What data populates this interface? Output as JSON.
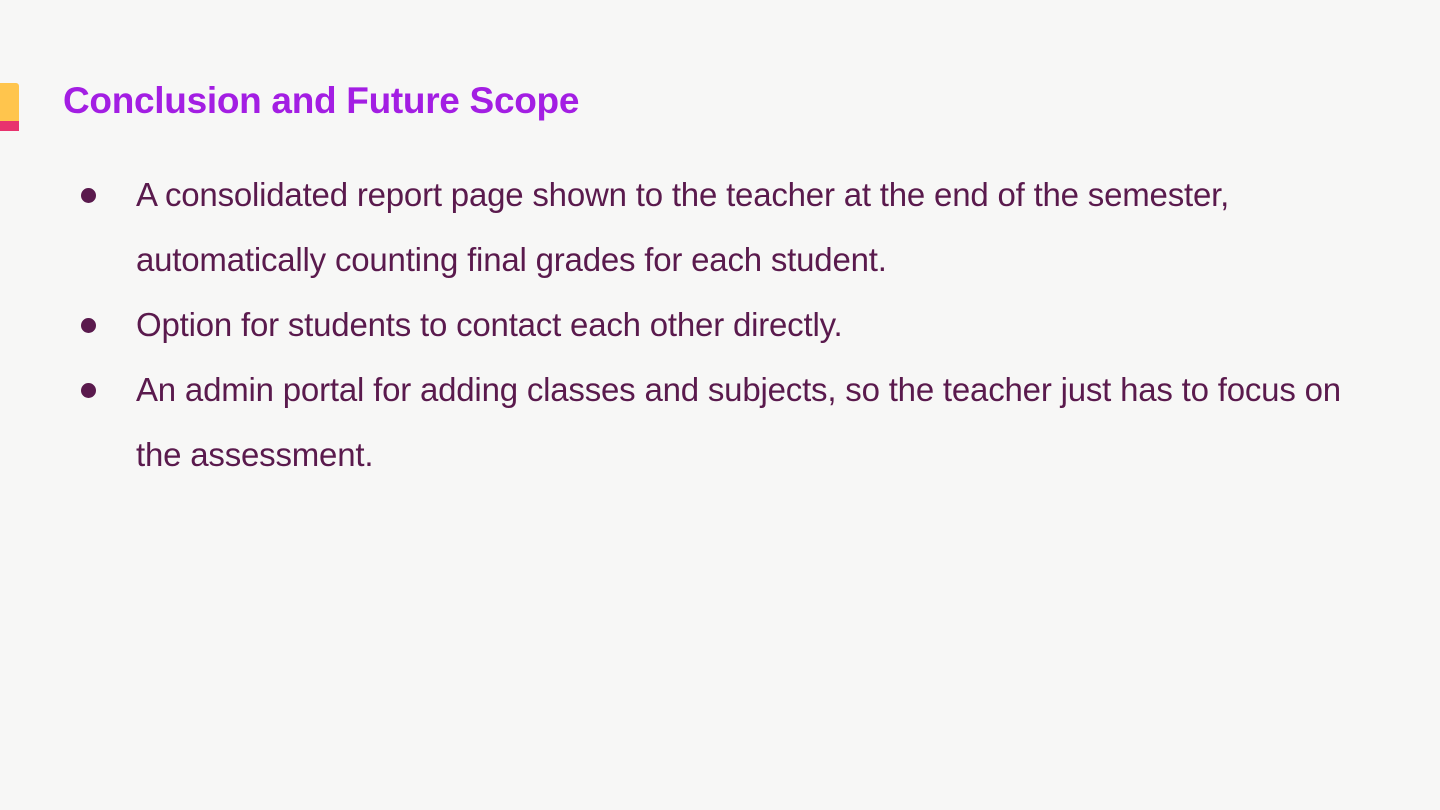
{
  "slide": {
    "title": "Conclusion and Future Scope",
    "bullets": [
      {
        "text": "A consolidated report page shown to the teacher at the end of the semester, automatically counting final grades for each student."
      },
      {
        "text": "Option for students to contact each other directly."
      },
      {
        "text": "An admin portal for adding classes and subjects, so the teacher just has to focus on  the assessment."
      }
    ]
  },
  "colors": {
    "background": "#f7f7f6",
    "title": "#a31ee3",
    "body_text": "#5a1a4d",
    "accent_yellow": "#ffc54d",
    "accent_pink": "#e8336e"
  }
}
